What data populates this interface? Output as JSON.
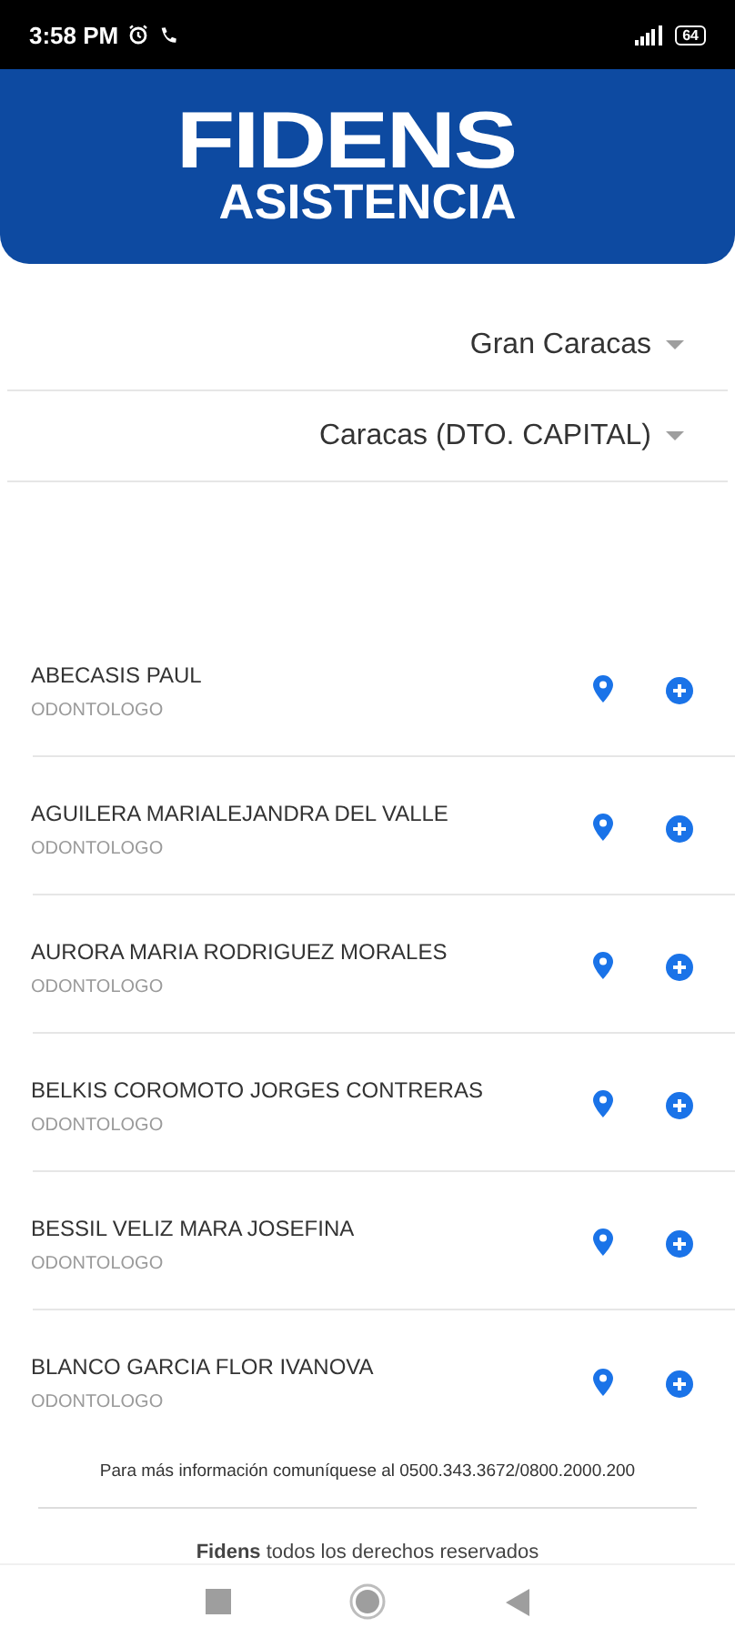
{
  "status_bar": {
    "time": "3:58 PM",
    "battery": "64"
  },
  "header": {
    "logo_top": "FIDENS",
    "logo_bottom": "ASISTENCIA"
  },
  "filters": [
    {
      "value": "Gran Caracas"
    },
    {
      "value": "Caracas (DTO. CAPITAL)"
    }
  ],
  "doctors": [
    {
      "name": "ABECASIS PAUL",
      "specialty": "ODONTOLOGO"
    },
    {
      "name": "AGUILERA MARIALEJANDRA DEL VALLE",
      "specialty": "ODONTOLOGO"
    },
    {
      "name": "AURORA MARIA RODRIGUEZ MORALES",
      "specialty": "ODONTOLOGO"
    },
    {
      "name": "BELKIS COROMOTO JORGES CONTRERAS",
      "specialty": "ODONTOLOGO"
    },
    {
      "name": "BESSIL VELIZ MARA JOSEFINA",
      "specialty": "ODONTOLOGO"
    },
    {
      "name": "BLANCO GARCIA FLOR IVANOVA",
      "specialty": "ODONTOLOGO"
    }
  ],
  "footer": {
    "info": "Para más información comuníquese al 0500.343.3672/0800.2000.200",
    "copyright": "**Fidens** todos los derechos reservados"
  }
}
